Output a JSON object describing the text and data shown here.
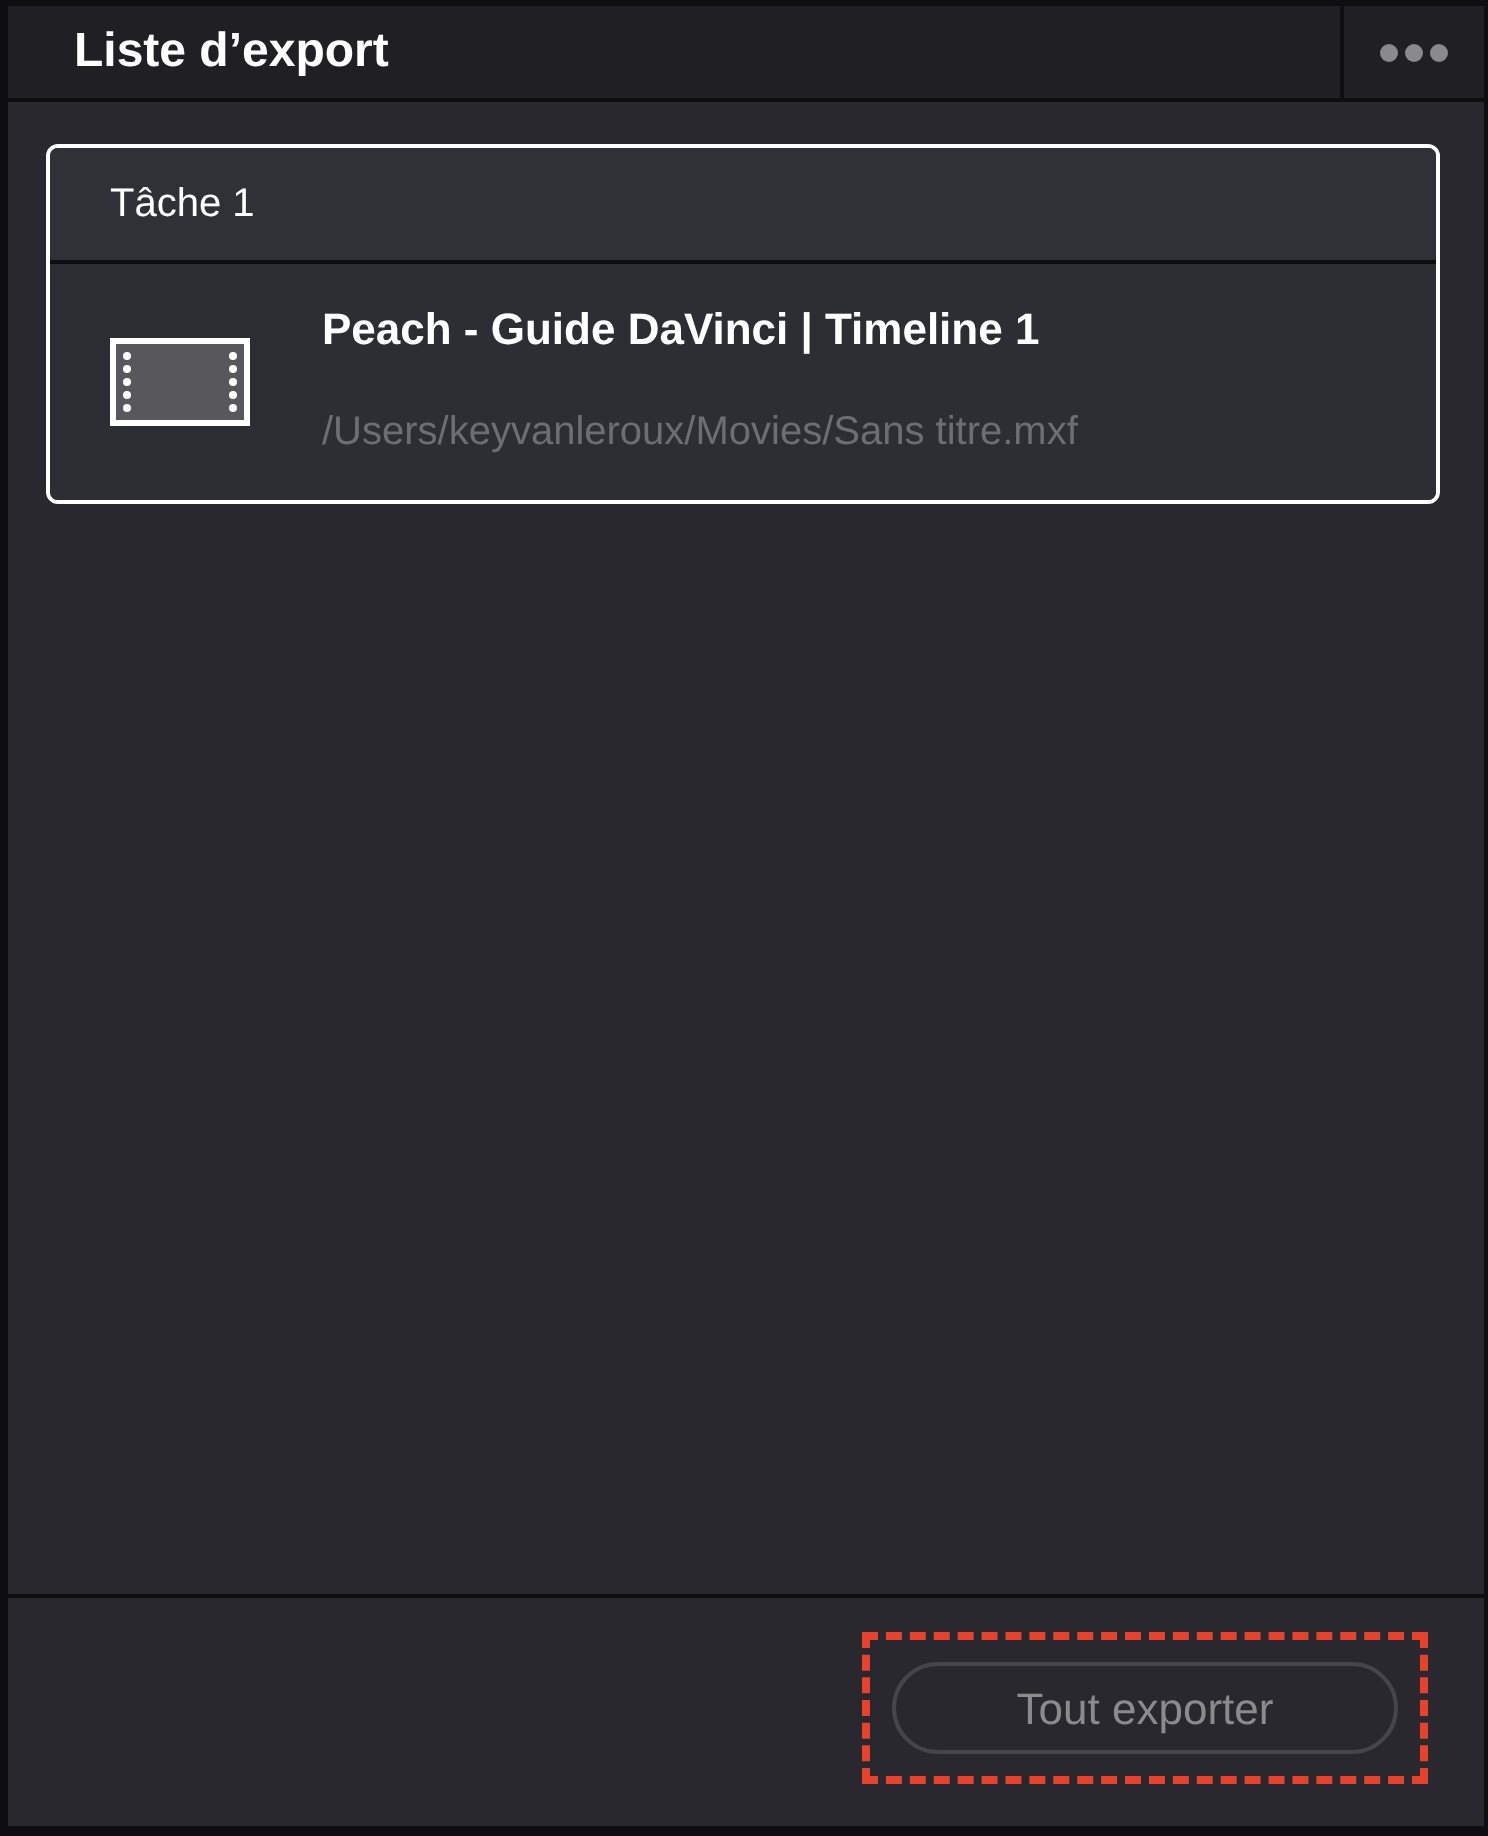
{
  "panel": {
    "title": "Liste d’export"
  },
  "jobs": [
    {
      "header": "Tâche 1",
      "selected": true,
      "items": [
        {
          "kind": "timeline",
          "title": "Peach - Guide DaVinci | Timeline 1",
          "path": "/Users/keyvanleroux/Movies/Sans titre.mxf"
        }
      ]
    }
  ],
  "footer": {
    "button": {
      "label": "Tout exporter",
      "disabled": true,
      "highlighted": true
    }
  }
}
